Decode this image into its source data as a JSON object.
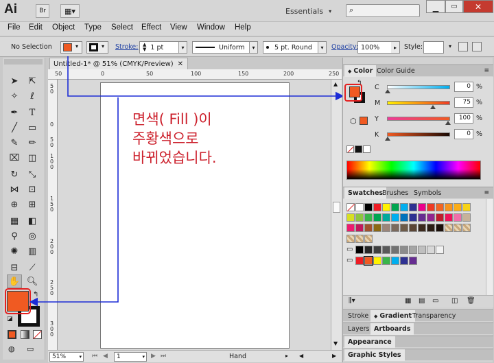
{
  "app": {
    "logo": "Ai",
    "bridge_label": "Br",
    "workspace": "Essentials",
    "search_placeholder": ""
  },
  "menu": [
    "File",
    "Edit",
    "Object",
    "Type",
    "Select",
    "Effect",
    "View",
    "Window",
    "Help"
  ],
  "control_bar": {
    "selection": "No Selection",
    "stroke_label": "Stroke:",
    "stroke_weight": "1 pt",
    "profile": "Uniform",
    "brush": "5 pt. Round",
    "opacity_label": "Opacity:",
    "opacity_value": "100%",
    "style_label": "Style:"
  },
  "document": {
    "tab_title": "Untitled-1* @ 51% (CMYK/Preview)",
    "ruler_h": [
      "50",
      "0",
      "50",
      "100",
      "150",
      "200",
      "250"
    ],
    "ruler_v": [
      "5\n0",
      "0",
      "5\n0",
      "1\n0\n0",
      "1\n5\n0",
      "2\n0\n0",
      "2\n5\n0",
      "3\n0\n0"
    ],
    "zoom": "51%",
    "page": "1",
    "tool_status": "Hand"
  },
  "annotation": {
    "line1": "면색( Fill )이",
    "line2": "주황색으로",
    "line3": "바뀌었습니다."
  },
  "color_panel": {
    "tab_color": "Color",
    "tab_guide": "Color Guide",
    "fill_color": "#f05a22",
    "sliders": [
      {
        "label": "C",
        "value": "0",
        "pos": 0.0,
        "grad": "linear-gradient(to right,#ffffff,#00aeef)"
      },
      {
        "label": "M",
        "value": "75",
        "pos": 0.75,
        "grad": "linear-gradient(to right,#ffee00,#ee3b24)"
      },
      {
        "label": "Y",
        "value": "100",
        "pos": 1.0,
        "grad": "linear-gradient(to right,#ee3b9a,#f05a22)"
      },
      {
        "label": "K",
        "value": "0",
        "pos": 0.0,
        "grad": "linear-gradient(to right,#f05a22,#1a0a05)"
      }
    ],
    "pct": "%"
  },
  "swatches_panel": {
    "tabs": [
      "Swatches",
      "Brushes",
      "Symbols"
    ]
  },
  "stacked_tabs": {
    "row1": [
      "Stroke",
      "Gradient",
      "Transparency"
    ],
    "row2": [
      "Layers",
      "Artboards"
    ],
    "row3": [
      "Appearance"
    ],
    "row4": [
      "Graphic Styles"
    ]
  }
}
